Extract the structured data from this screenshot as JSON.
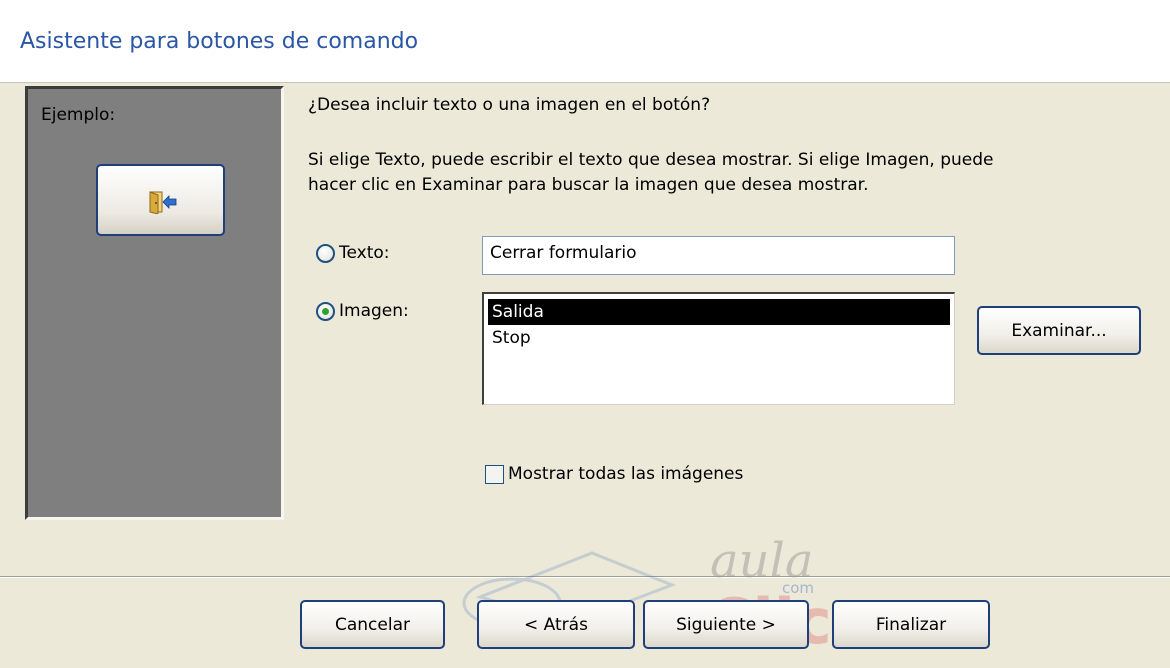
{
  "window": {
    "title": "Asistente para botones de comando"
  },
  "example": {
    "label": "Ejemplo:",
    "icon": "exit-door-icon"
  },
  "prompt": {
    "question": "¿Desea incluir texto o una imagen en el botón?",
    "description_line1": "Si elige Texto, puede escribir el texto que desea mostrar. Si elige Imagen, puede",
    "description_line2": "hacer clic en Examinar para buscar la imagen que desea mostrar."
  },
  "options": {
    "text_label": "Texto:",
    "text_value": "Cerrar formulario",
    "image_label": "Imagen:",
    "selected": "Imagen"
  },
  "image_list": {
    "items": [
      "Salida",
      "Stop"
    ],
    "selected": "Salida"
  },
  "browse_button": "Examinar...",
  "show_all_checkbox": {
    "label": "Mostrar todas las imágenes",
    "checked": false
  },
  "footer": {
    "cancel": "Cancelar",
    "back": "< Atrás",
    "next": "Siguiente >",
    "finish": "Finalizar"
  },
  "watermark": {
    "top": "aula",
    "middle": "com",
    "bottom": "Clic"
  },
  "colors": {
    "title": "#2a56a6",
    "dialog_bg": "#ece9d8",
    "example_bg": "#7f7f7f",
    "button_border": "#1f3f7a"
  }
}
